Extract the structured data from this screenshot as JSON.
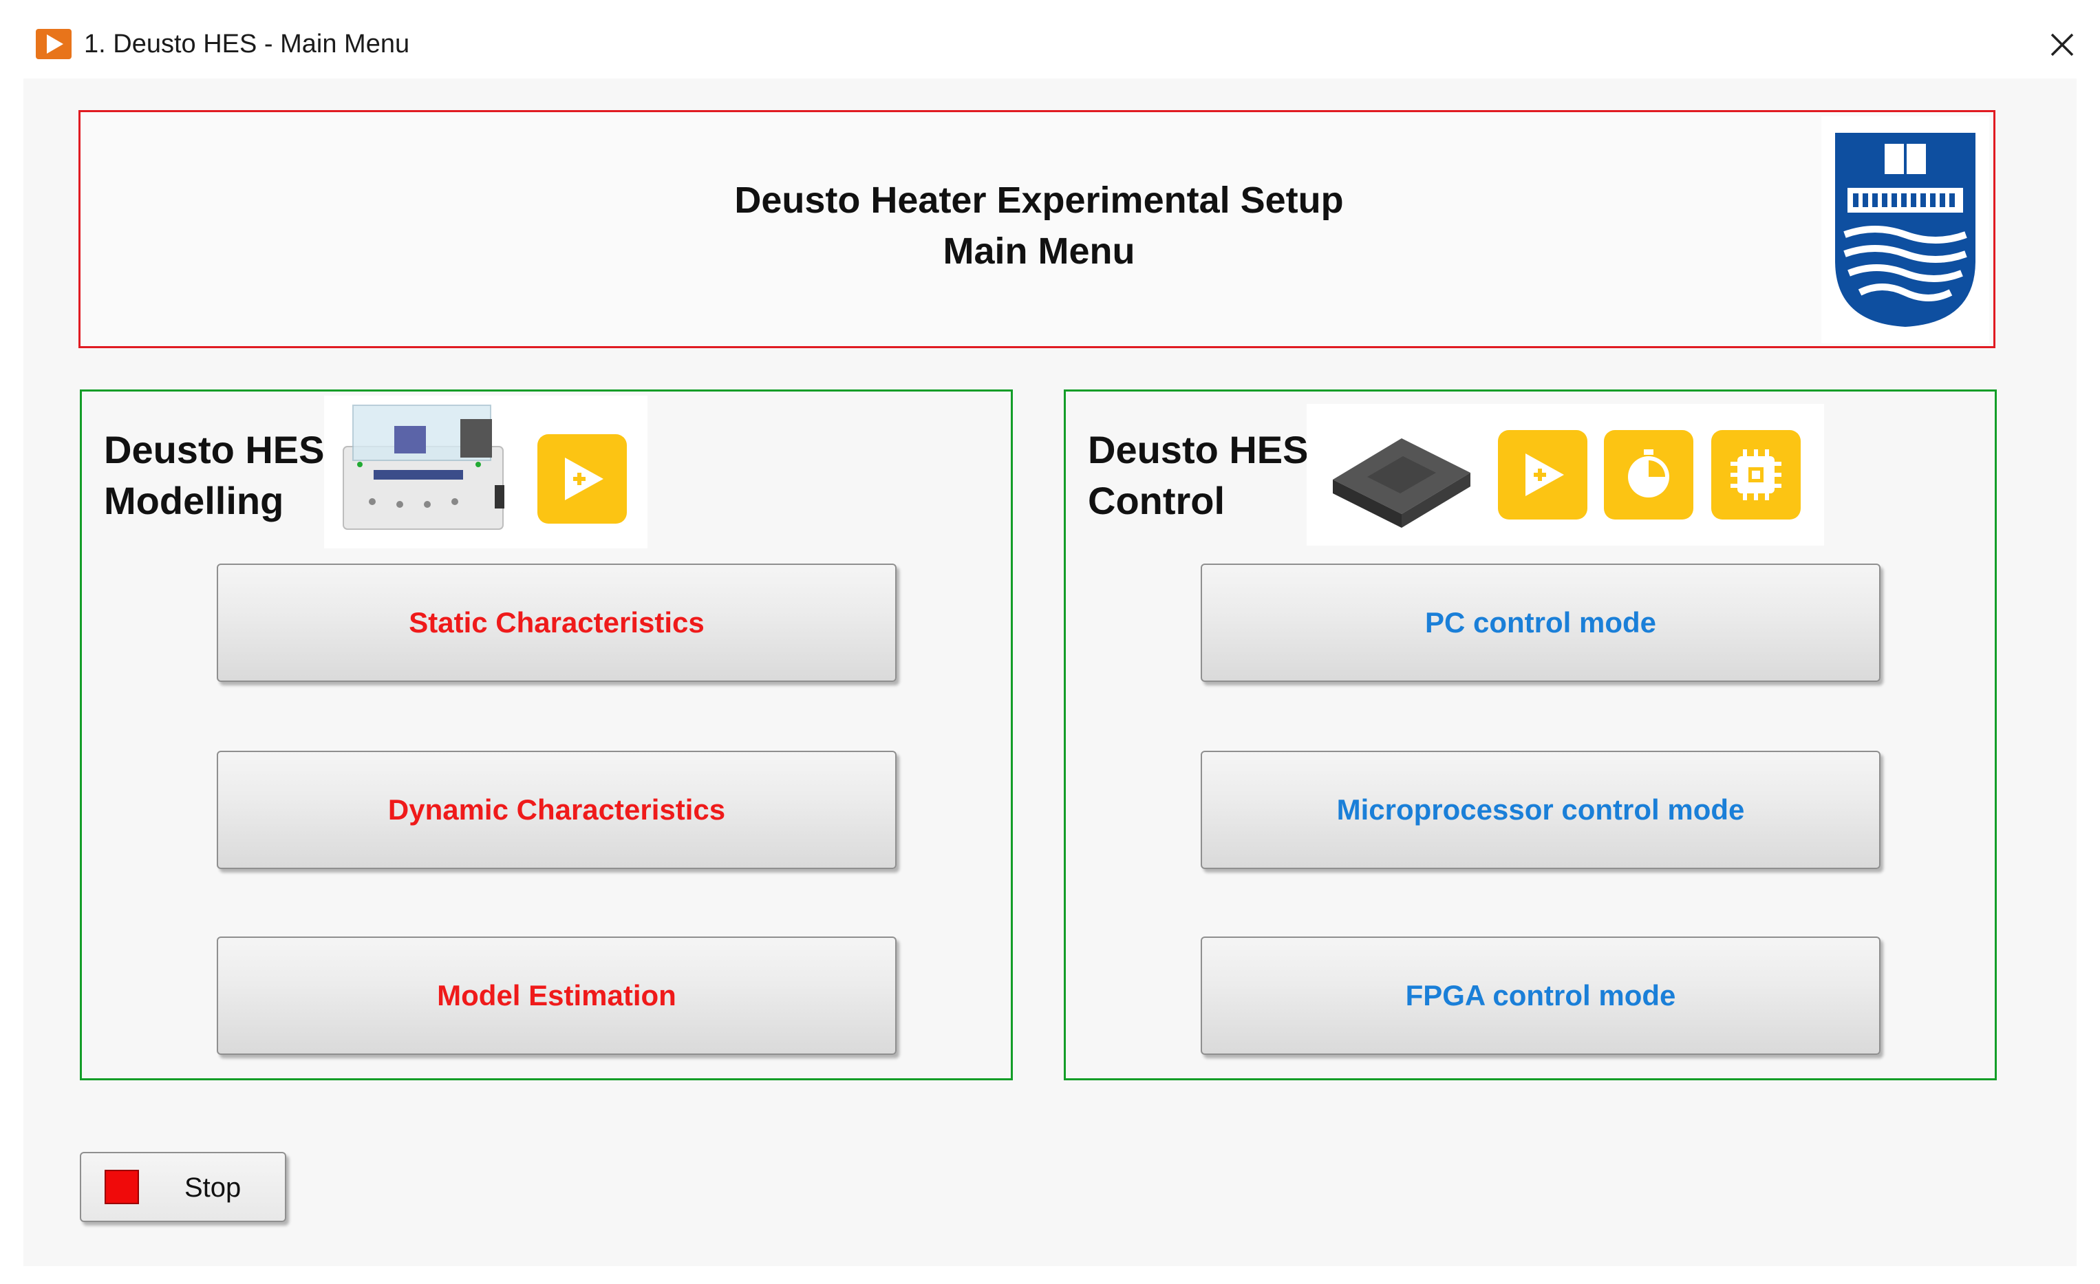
{
  "window": {
    "title": "1. Deusto HES - Main Menu",
    "close_icon": "close-icon",
    "app_icon": "labview-run-icon"
  },
  "banner": {
    "title": "Deusto Heater Experimental Setup",
    "subtitle": "Main Menu",
    "logo_icon": "university-shield-logo"
  },
  "modelling": {
    "title": "Deusto HES Modelling",
    "icons": [
      "heater-device-image",
      "labview-run-icon"
    ],
    "buttons": [
      "Static Characteristics",
      "Dynamic Characteristics",
      "Model Estimation"
    ]
  },
  "control": {
    "title": "Deusto HES Control",
    "icons": [
      "control-board-image",
      "labview-run-icon",
      "realtime-timer-icon",
      "fpga-chip-icon"
    ],
    "buttons": [
      "PC control mode",
      "Microprocessor control mode",
      "FPGA control mode"
    ]
  },
  "stop": {
    "label": "Stop"
  },
  "colors": {
    "banner_border": "#e01b22",
    "group_border": "#139d28",
    "modelling_text": "#ef1a1a",
    "control_text": "#1a7fd8",
    "icon_yellow": "#fcc413"
  }
}
